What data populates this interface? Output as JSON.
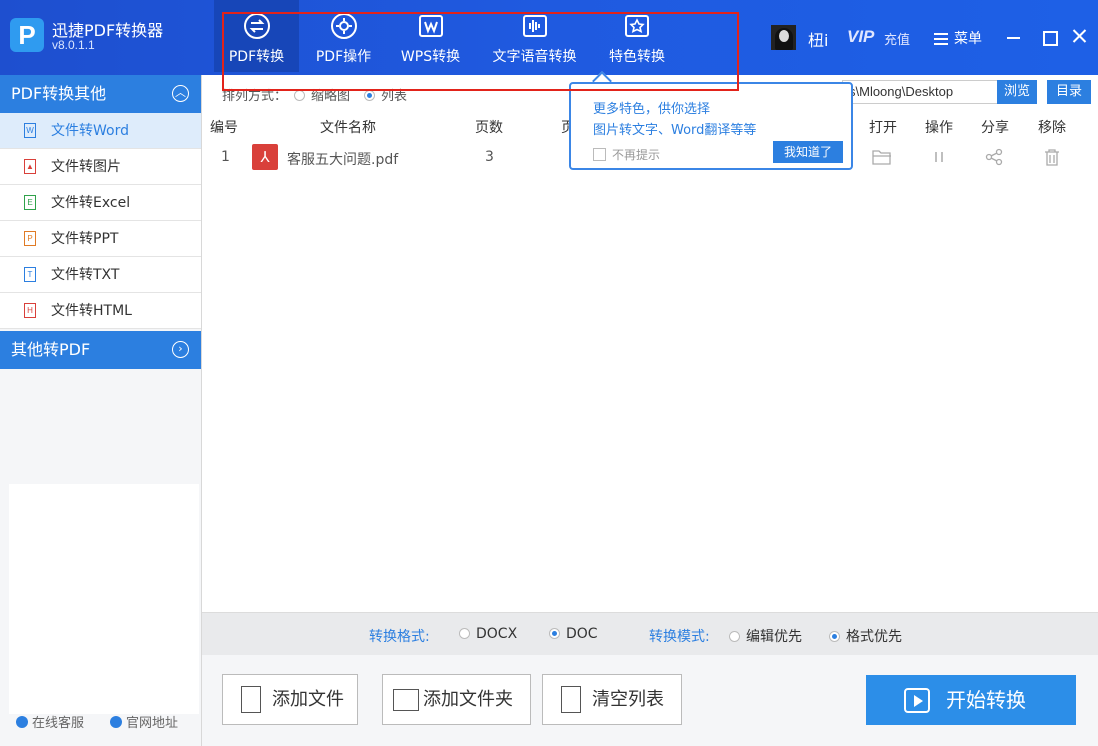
{
  "app": {
    "name": "迅捷PDF转换器",
    "version": "v8.0.1.1",
    "logo_letter": "P"
  },
  "nav": {
    "tabs": [
      {
        "label": "PDF转换",
        "icon": "convert-arrows-icon",
        "active": true
      },
      {
        "label": "PDF操作",
        "icon": "gear-icon",
        "active": false
      },
      {
        "label": "WPS转换",
        "icon": "wps-icon",
        "active": false
      },
      {
        "label": "文字语音转换",
        "icon": "soundwave-icon",
        "active": false
      },
      {
        "label": "特色转换",
        "icon": "star-icon",
        "active": false
      }
    ]
  },
  "header": {
    "username": "杻i",
    "vip": "VIP",
    "recharge": "充值",
    "menu": "菜单"
  },
  "sidebar": {
    "section1": "PDF转换其他",
    "items": [
      {
        "label": "文件转Word",
        "icon": "word-file-icon",
        "glyph": "W",
        "color": "#2c7fe0",
        "active": true
      },
      {
        "label": "文件转图片",
        "icon": "image-file-icon",
        "glyph": "▲",
        "color": "#d9403a",
        "active": false
      },
      {
        "label": "文件转Excel",
        "icon": "excel-file-icon",
        "glyph": "E",
        "color": "#2fa24a",
        "active": false
      },
      {
        "label": "文件转PPT",
        "icon": "ppt-file-icon",
        "glyph": "P",
        "color": "#e07b25",
        "active": false
      },
      {
        "label": "文件转TXT",
        "icon": "txt-file-icon",
        "glyph": "T",
        "color": "#2c7fe0",
        "active": false
      },
      {
        "label": "文件转HTML",
        "icon": "html-file-icon",
        "glyph": "H",
        "color": "#d9403a",
        "active": false
      }
    ],
    "section2": "其他转PDF",
    "footer_service": "在线客服",
    "footer_site": "官网地址"
  },
  "sort": {
    "label": "排列方式：",
    "thumbnail": "缩略图",
    "list": "列表",
    "selected": "list"
  },
  "output_path": "s\\Mloong\\Desktop",
  "buttons": {
    "browse": "浏览",
    "directory": "目录"
  },
  "table": {
    "headers": {
      "num": "编号",
      "name": "文件名称",
      "pages": "页数",
      "range": "页",
      "open": "打开",
      "action": "操作",
      "share": "分享",
      "remove": "移除"
    },
    "rows": [
      {
        "num": "1",
        "name": "客服五大问题.pdf",
        "pages": "3"
      }
    ]
  },
  "tooltip": {
    "line1": "更多特色，供你选择",
    "line2": "图片转文字、Word翻译等等",
    "dont_show": "不再提示",
    "ok": "我知道了"
  },
  "format": {
    "format_label": "转换格式:",
    "docx": "DOCX",
    "doc": "DOC",
    "selected_format": "DOC",
    "mode_label": "转换模式:",
    "edit_first": "编辑优先",
    "format_first": "格式优先",
    "selected_mode": "格式优先"
  },
  "actions": {
    "add_file": "添加文件",
    "add_folder": "添加文件夹",
    "clear_list": "清空列表",
    "start": "开始转换"
  },
  "colors": {
    "title_bar": "#1f5ae0",
    "accent": "#2c7fe0",
    "highlight": "#e2231a",
    "pdf_red": "#d9403a"
  }
}
